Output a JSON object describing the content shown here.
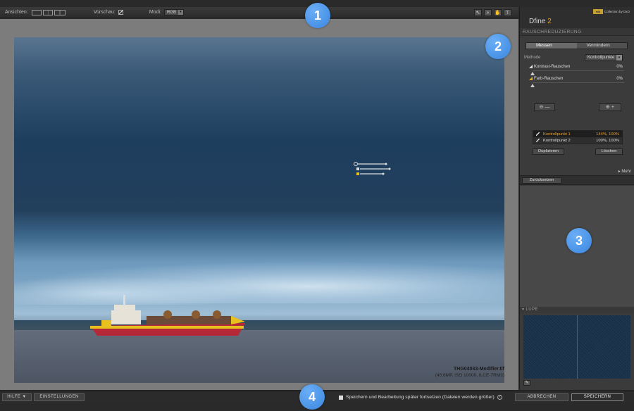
{
  "toolbar": {
    "views_label": "Ansichten:",
    "preview_label": "Vorschau:",
    "mode_label": "Modi:",
    "mode_value": "RGB"
  },
  "image": {
    "filename": "THG04033-Modifier.tif",
    "meta": "(40.6MP, ISO 10000, ILCE-7RM3)"
  },
  "panel": {
    "brand_name": "Dfine",
    "brand_version": "2",
    "collection_label": "Collection by DxO",
    "section_title": "RAUSCHREDUZIERUNG",
    "tabs": [
      {
        "label": "Messen"
      },
      {
        "label": "Vermindern"
      }
    ],
    "method_label": "Methode",
    "method_value": "Kontrollpunkte",
    "sliders": [
      {
        "label": "Kontrast-Rauschen",
        "value": "0%"
      },
      {
        "label": "Farb-Rauschen",
        "value": "0%"
      }
    ],
    "control_points": [
      {
        "name": "Kontrollpunkt 1",
        "value": "144%, 100%"
      },
      {
        "name": "Kontrollpunkt 2",
        "value": "100%, 100%"
      }
    ],
    "duplicate_label": "Duplizieren",
    "delete_label": "Löschen",
    "more_label": "▸ Mehr",
    "reset_label": "Zurücksetzen",
    "loupe_title": "▾ LUPE"
  },
  "bottom": {
    "help_label": "HILFE ▼",
    "settings_label": "EINSTELLUNGEN",
    "save_later_label": "Speichern und Bearbeitung später fortsetzen (Dateien werden größer)",
    "cancel_label": "ABBRECHEN",
    "save_label": "SPEICHERN"
  },
  "callouts": [
    "1",
    "2",
    "3",
    "4"
  ]
}
